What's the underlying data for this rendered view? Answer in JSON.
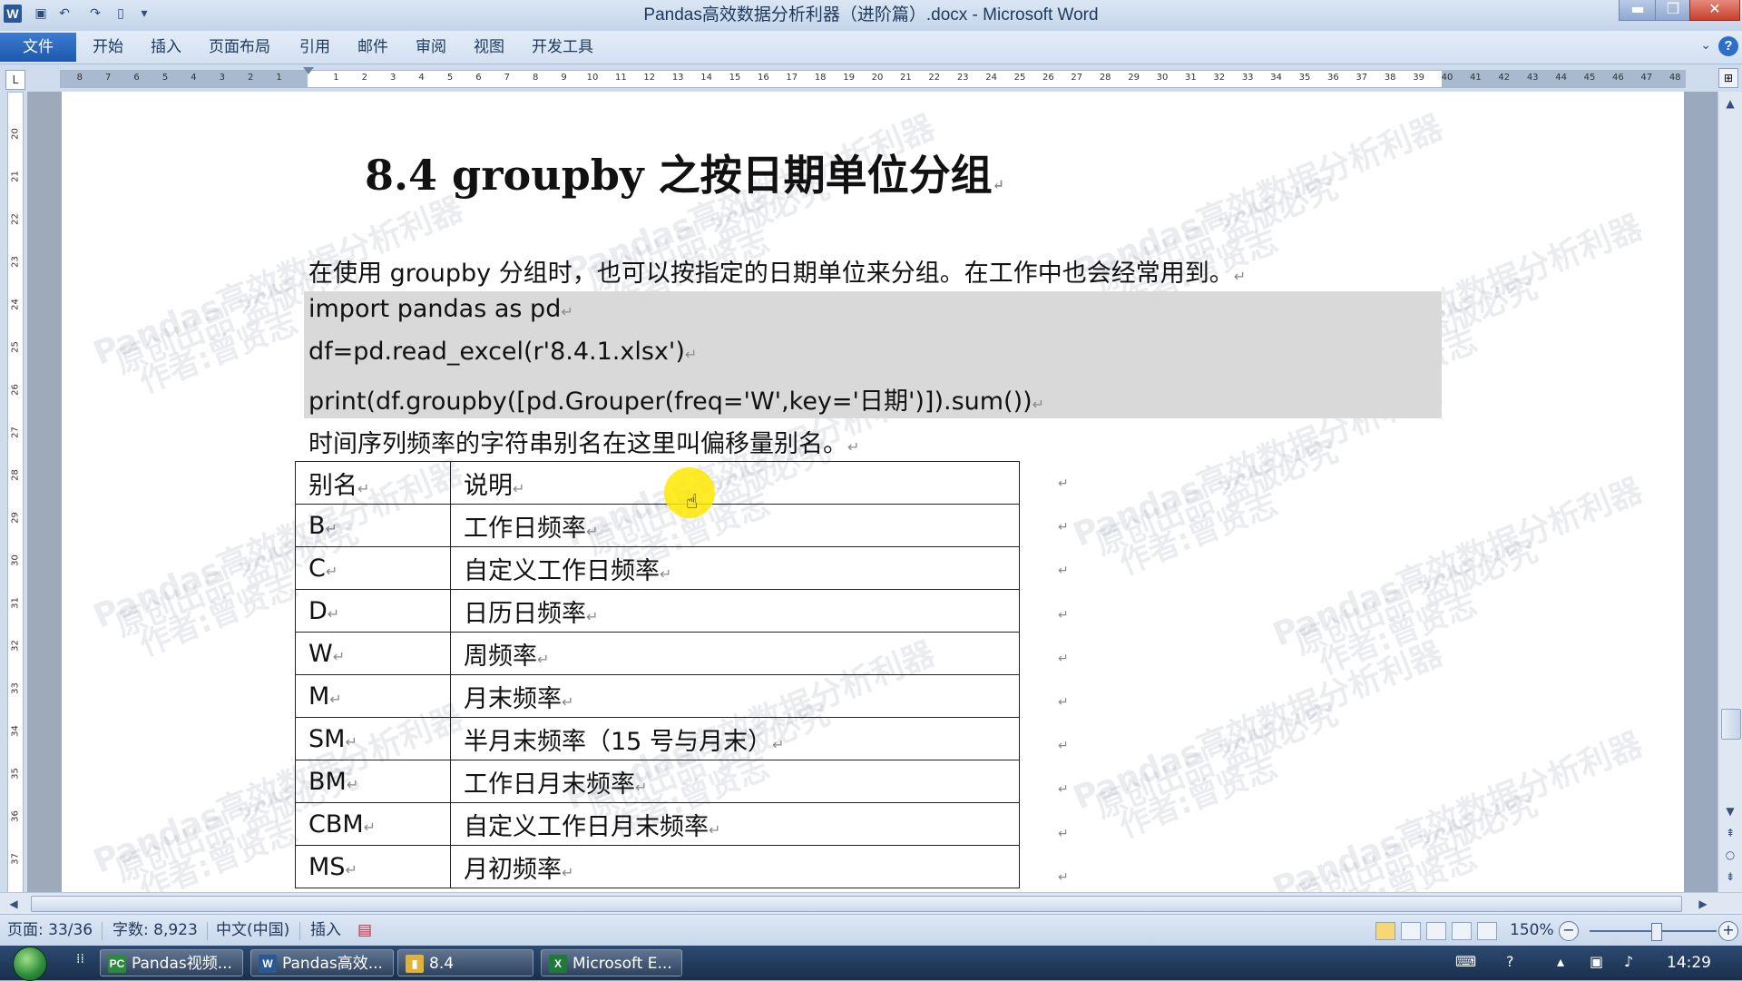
{
  "window": {
    "title": "Pandas高效数据分析利器（进阶篇）.docx - Microsoft Word",
    "app_logo": "W",
    "controls": [
      "minimize-icon",
      "maximize-icon",
      "close-icon"
    ]
  },
  "quick_access": [
    "save-icon",
    "undo-icon",
    "redo-icon",
    "new-doc-icon",
    "customize-icon"
  ],
  "ribbon": {
    "file_tab": "文件",
    "tabs": [
      "开始",
      "插入",
      "页面布局",
      "引用",
      "邮件",
      "审阅",
      "视图",
      "开发工具"
    ]
  },
  "ruler": {
    "tab_selector": "L",
    "left_numbers": [
      "8",
      "7",
      "6",
      "5",
      "4",
      "3",
      "2",
      "1"
    ],
    "right_numbers": [
      "1",
      "2",
      "3",
      "4",
      "5",
      "6",
      "7",
      "8",
      "9",
      "10",
      "11",
      "12",
      "13",
      "14",
      "15",
      "16",
      "17",
      "18",
      "19",
      "20",
      "21",
      "22",
      "23",
      "24",
      "25",
      "26",
      "27",
      "28",
      "29",
      "30",
      "31",
      "32",
      "33",
      "34",
      "35",
      "36",
      "37",
      "38",
      "39",
      "40",
      "41",
      "42",
      "43",
      "44",
      "45",
      "46",
      "47",
      "48"
    ],
    "vertical_numbers": [
      "20",
      "21",
      "22",
      "23",
      "24",
      "25",
      "26",
      "27",
      "28",
      "29",
      "30",
      "31",
      "32",
      "33",
      "34",
      "35",
      "36",
      "37"
    ]
  },
  "document": {
    "heading": "8.4 groupby 之按日期单位分组",
    "intro": "在使用 groupby 分组时，也可以按指定的日期单位来分组。在工作中也会经常用到。",
    "code_lines": [
      "import pandas as pd",
      "df=pd.read_excel(r'8.4.1.xlsx')",
      "print(df.groupby([pd.Grouper(freq='W',key='日期')]).sum())"
    ],
    "note": "时间序列频率的字符串别名在这里叫偏移量别名。",
    "table": {
      "headers": [
        "别名",
        "说明"
      ],
      "rows": [
        [
          "B",
          "工作日频率"
        ],
        [
          "C",
          "自定义工作日频率"
        ],
        [
          "D",
          "日历日频率"
        ],
        [
          "W",
          "周频率"
        ],
        [
          "M",
          "月末频率"
        ],
        [
          "SM",
          "半月末频率（15 号与月末）"
        ],
        [
          "BM",
          "工作日月末频率"
        ],
        [
          "CBM",
          "自定义工作日月末频率"
        ],
        [
          "MS",
          "月初频率"
        ]
      ]
    },
    "paragraph_mark": "↵",
    "watermark_lines": [
      "Pandas高效数据分析利器",
      "原创出品  盗版必究",
      "作者:曾贤志"
    ]
  },
  "statusbar": {
    "page": "页面: 33/36",
    "words": "字数: 8,923",
    "language": "中文(中国)",
    "mode": "插入",
    "zoom": "150%",
    "zoom_minus": "−",
    "zoom_plus": "+",
    "zoom_level": 1.5
  },
  "taskbar": {
    "items": [
      {
        "label": "Pandas视频...",
        "icon": "PC",
        "color": "#2b8a3e"
      },
      {
        "label": "Pandas高效...",
        "icon": "W",
        "color": "#2b5797"
      },
      {
        "label": "8.4",
        "icon": "▮",
        "color": "#e0b23a"
      },
      {
        "label": "Microsoft E...",
        "icon": "X",
        "color": "#1f7a3a"
      }
    ],
    "clock": "14:29"
  }
}
